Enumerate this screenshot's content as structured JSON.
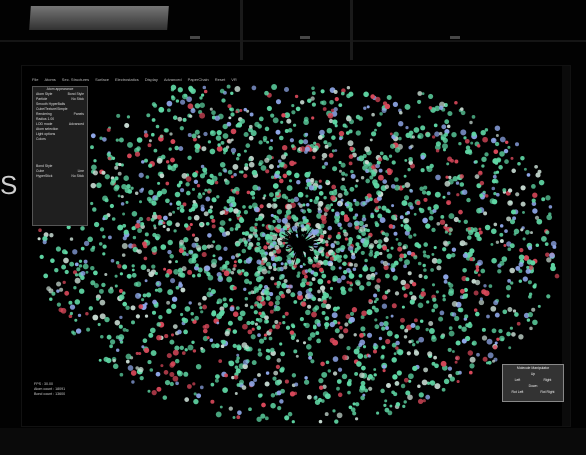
{
  "menubar": {
    "items": [
      "File",
      "Atoms",
      "Sec. Structures",
      "Surface",
      "Electrostatics",
      "Display",
      "Advanced",
      "PaperChain",
      "Reset",
      "VR"
    ]
  },
  "panel": {
    "header": "Atom appearance",
    "rows": [
      {
        "left": "Atom Style",
        "right": "Bond Style"
      },
      {
        "left": "Particle",
        "right": "No Stick"
      },
      {
        "left": "Smooth HyperBalls",
        "right": ""
      },
      {
        "left": "Cube/Texture/Simple",
        "right": ""
      },
      {
        "left": "Rendering",
        "right": "Panels"
      },
      {
        "left": "Radius 1.00",
        "right": ""
      },
      {
        "left": "LOD mode",
        "right": "Advanced"
      },
      {
        "left": "Atom selection",
        "right": ""
      },
      {
        "left": "Light options",
        "right": ""
      },
      {
        "left": "Colors",
        "right": ""
      }
    ],
    "lower_rows": [
      {
        "left": "Bond Style",
        "right": ""
      },
      {
        "left": "Cube",
        "right": "Line"
      },
      {
        "left": "HyperStick",
        "right": "No Stick"
      }
    ]
  },
  "manipulator": {
    "title": "Molecule Manipulator",
    "up": "Up",
    "left": "Left",
    "right": "Right",
    "down": "Down",
    "rot_left": "Rot Left",
    "rot_right": "Rot Right"
  },
  "stats": {
    "fps": "FPS : 30.00",
    "atom_count": "Atom count : 18091",
    "bond_count": "Bond count : 13600"
  },
  "bottom_label": "FPS",
  "edge_letter": "S",
  "colors": {
    "atom_green": "#5fd6a4",
    "atom_red": "#d8485a",
    "atom_blue": "#8fa7e8",
    "atom_pale": "#c6d9d0",
    "panel_bg": "#282828"
  }
}
